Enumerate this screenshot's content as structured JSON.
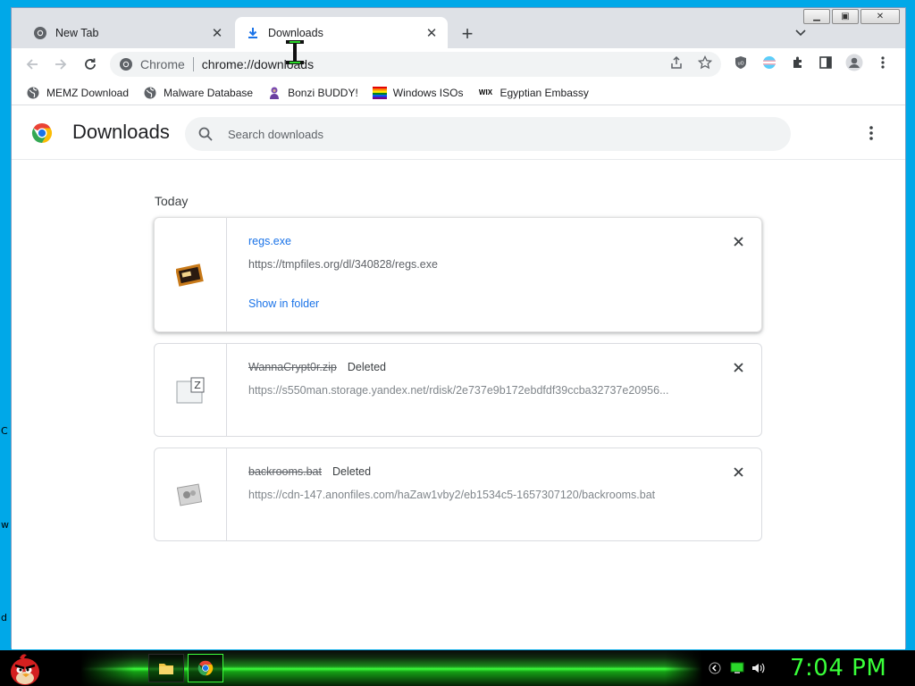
{
  "desktop": {
    "fragments": [
      "C",
      "w",
      "d"
    ]
  },
  "browser": {
    "tabs": [
      {
        "title": "New Tab",
        "icon": "chrome-icon",
        "active": false
      },
      {
        "title": "Downloads",
        "icon": "download-icon",
        "active": true
      }
    ],
    "omnibox": {
      "site_name": "Chrome",
      "url": "chrome://downloads"
    },
    "bookmarks": [
      {
        "label": "MEMZ Download",
        "icon": "globe-icon"
      },
      {
        "label": "Malware Database",
        "icon": "globe-icon"
      },
      {
        "label": "Bonzi BUDDY!",
        "icon": "bonzi-icon"
      },
      {
        "label": "Windows ISOs",
        "icon": "rainbow-flag-icon"
      },
      {
        "label": "Egyptian Embassy",
        "icon": "wix-icon"
      }
    ],
    "bookmark_wix_text": "WIX"
  },
  "downloads_page": {
    "title": "Downloads",
    "search_placeholder": "Search downloads",
    "section_label": "Today",
    "items": [
      {
        "filename": "regs.exe",
        "status": "",
        "url": "https://tmpfiles.org/dl/340828/regs.exe",
        "action": "Show in folder",
        "deleted": false
      },
      {
        "filename": "WannaCrypt0r.zip",
        "status": "Deleted",
        "url": "https://s550man.storage.yandex.net/rdisk/2e737e9b172ebdfdf39ccba32737e20956...",
        "action": "",
        "deleted": true
      },
      {
        "filename": "backrooms.bat",
        "status": "Deleted",
        "url": "https://cdn-147.anonfiles.com/haZaw1vby2/eb1534c5-1657307120/backrooms.bat",
        "action": "",
        "deleted": true
      }
    ]
  },
  "taskbar": {
    "clock": "7:04 PM"
  },
  "colors": {
    "desktop": "#00a8e8",
    "link_blue": "#1a73e8",
    "clock_green": "#39ff39"
  }
}
